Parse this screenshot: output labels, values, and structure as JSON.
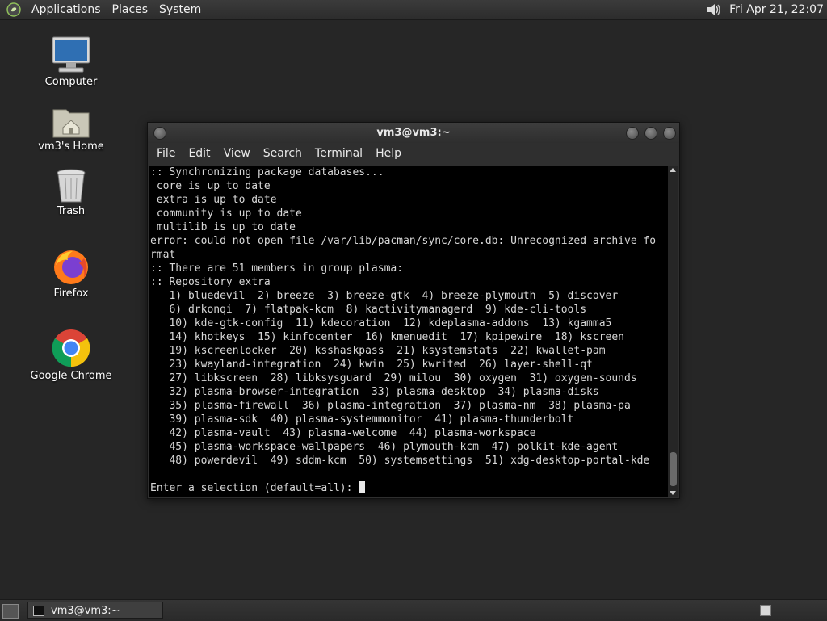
{
  "top_panel": {
    "menus": [
      "Applications",
      "Places",
      "System"
    ],
    "clock": "Fri Apr 21, 22:07",
    "logo_icon": "gnome-foot-icon",
    "volume_icon": "speaker-icon"
  },
  "desktop_icons": [
    {
      "label": "Computer",
      "icon": "computer-monitor-icon"
    },
    {
      "label": "vm3's Home",
      "icon": "home-folder-icon"
    },
    {
      "label": "Trash",
      "icon": "trash-bin-icon"
    },
    {
      "label": "Firefox",
      "icon": "firefox-icon"
    },
    {
      "label": "Google Chrome",
      "icon": "chrome-icon"
    }
  ],
  "terminal": {
    "title": "vm3@vm3:~",
    "menu": [
      "File",
      "Edit",
      "View",
      "Search",
      "Terminal",
      "Help"
    ],
    "lines": [
      ":: Synchronizing package databases...",
      " core is up to date",
      " extra is up to date",
      " community is up to date",
      " multilib is up to date",
      "error: could not open file /var/lib/pacman/sync/core.db: Unrecognized archive fo",
      "rmat",
      ":: There are 51 members in group plasma:",
      ":: Repository extra",
      "   1) bluedevil  2) breeze  3) breeze-gtk  4) breeze-plymouth  5) discover",
      "   6) drkonqi  7) flatpak-kcm  8) kactivitymanagerd  9) kde-cli-tools",
      "   10) kde-gtk-config  11) kdecoration  12) kdeplasma-addons  13) kgamma5",
      "   14) khotkeys  15) kinfocenter  16) kmenuedit  17) kpipewire  18) kscreen",
      "   19) kscreenlocker  20) ksshaskpass  21) ksystemstats  22) kwallet-pam",
      "   23) kwayland-integration  24) kwin  25) kwrited  26) layer-shell-qt",
      "   27) libkscreen  28) libksysguard  29) milou  30) oxygen  31) oxygen-sounds",
      "   32) plasma-browser-integration  33) plasma-desktop  34) plasma-disks",
      "   35) plasma-firewall  36) plasma-integration  37) plasma-nm  38) plasma-pa",
      "   39) plasma-sdk  40) plasma-systemmonitor  41) plasma-thunderbolt",
      "   42) plasma-vault  43) plasma-welcome  44) plasma-workspace",
      "   45) plasma-workspace-wallpapers  46) plymouth-kcm  47) polkit-kde-agent",
      "   48) powerdevil  49) sddm-kcm  50) systemsettings  51) xdg-desktop-portal-kde",
      ""
    ],
    "prompt": "Enter a selection (default=all): "
  },
  "bottom_panel": {
    "taskbar_item": "vm3@vm3:~",
    "taskbar_icon": "terminal-icon",
    "show_desktop_icon": "show-desktop-icon",
    "workspace_icon": "workspace-switcher-icon"
  }
}
